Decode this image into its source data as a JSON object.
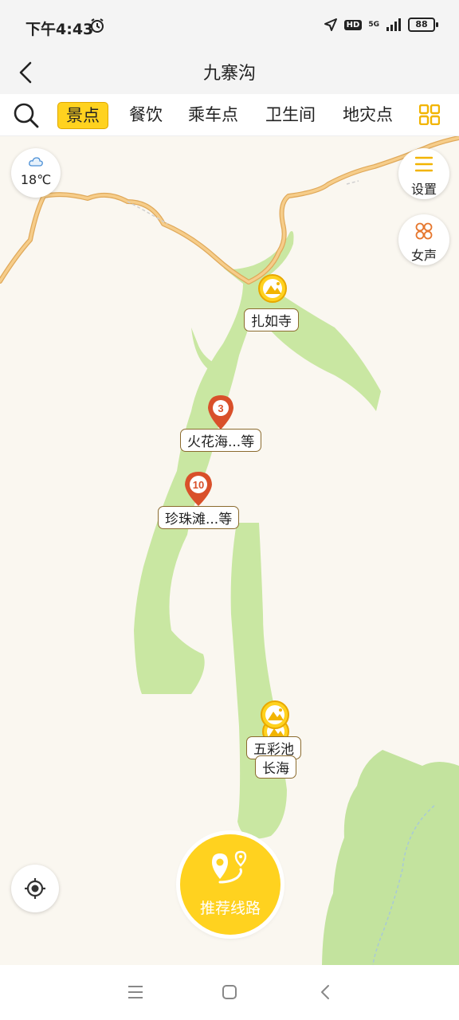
{
  "status_bar": {
    "time": "下午4:43",
    "hd": "HD",
    "network": "5G",
    "battery": "88"
  },
  "header": {
    "title": "九寨沟"
  },
  "tabs": [
    {
      "label": "景点",
      "active": true
    },
    {
      "label": "餐饮",
      "active": false
    },
    {
      "label": "乘车点",
      "active": false
    },
    {
      "label": "卫生间",
      "active": false
    },
    {
      "label": "地灾点",
      "active": false
    }
  ],
  "weather": {
    "temperature": "18℃",
    "icon": "cloud-icon"
  },
  "controls": {
    "settings_label": "设置",
    "voice_label": "女声"
  },
  "map": {
    "pins": [
      {
        "label": "扎如寺",
        "type": "scenic-spot"
      },
      {
        "label": "火花海...等",
        "count": "3",
        "type": "cluster"
      },
      {
        "label": "珍珠滩...等",
        "count": "10",
        "type": "cluster"
      },
      {
        "label": "五彩池",
        "type": "scenic-spot"
      },
      {
        "label": "长海",
        "type": "scenic-spot"
      }
    ]
  },
  "route_button": {
    "label": "推荐线路"
  },
  "colors": {
    "accent": "#ffd21f",
    "cluster_pin": "#d9502a",
    "park_green": "#c9e7a2",
    "road": "#f3c27a"
  }
}
